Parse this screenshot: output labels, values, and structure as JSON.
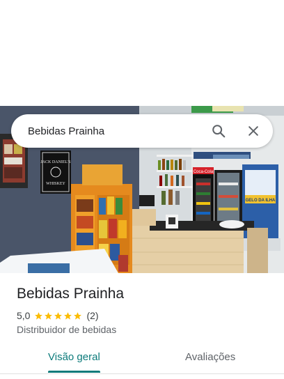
{
  "search": {
    "query": "Bebidas Prainha"
  },
  "place": {
    "name": "Bebidas Prainha",
    "rating": "5,0",
    "stars": 5,
    "review_count": "(2)",
    "category": "Distribuidor de bebidas"
  },
  "photo": {
    "sign_jack": "JACK DANIEL'S",
    "sign_whiskey": "WHISKEY",
    "sign_coke": "Coca-Cola",
    "banner": "GELO DA ILHA"
  },
  "tabs": [
    {
      "label": "Visão geral",
      "active": true
    },
    {
      "label": "Avaliações",
      "active": false
    }
  ],
  "colors": {
    "accent": "#0b7a7a",
    "star": "#fbbc04"
  }
}
